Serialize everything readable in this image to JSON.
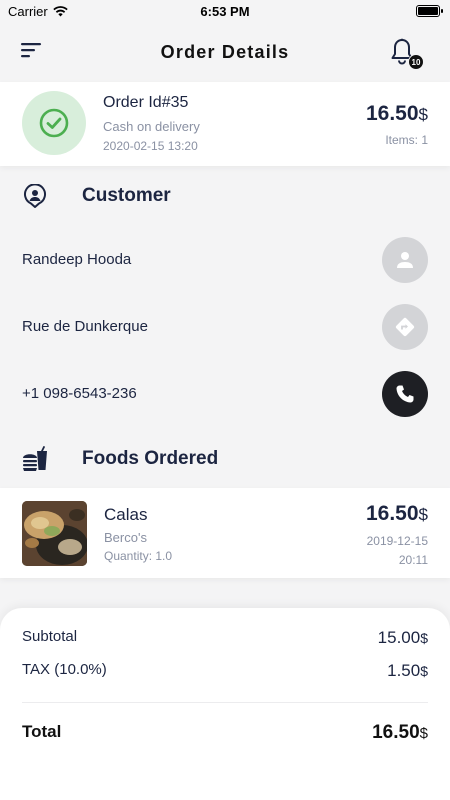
{
  "status_bar": {
    "carrier": "Carrier",
    "time": "6:53 PM"
  },
  "nav": {
    "title": "Order Details",
    "notification_count": "10"
  },
  "order": {
    "id_label": "Order Id#35",
    "payment_method": "Cash on delivery",
    "date": "2020-02-15 13:20",
    "price": "16.50",
    "currency": "$",
    "items": "Items: 1"
  },
  "customer": {
    "section_title": "Customer",
    "name": "Randeep Hooda",
    "address": "Rue de Dunkerque",
    "phone": "+1 098-6543-236"
  },
  "foods": {
    "section_title": "Foods Ordered",
    "items": [
      {
        "name": "Calas",
        "restaurant": "Berco's",
        "quantity": "Quantity: 1.0",
        "price": "16.50",
        "currency": "$",
        "date": "2019-12-15",
        "time": "20:11"
      }
    ]
  },
  "totals": {
    "subtotal_label": "Subtotal",
    "subtotal_value": "15.00",
    "tax_label": "TAX (10.0%)",
    "tax_value": "1.50",
    "total_label": "Total",
    "total_value": "16.50",
    "currency": "$"
  },
  "colors": {
    "primary": "#1c2541",
    "muted": "#8a91a3",
    "success": "#4caf50",
    "success_bg": "#d8eedb",
    "button_gray": "#d3d4d7",
    "button_dark": "#1e1f24"
  },
  "icons": {
    "menu": "menu-icon",
    "notification": "bell-icon",
    "check": "check-circle-icon",
    "customer": "user-pin-icon",
    "person": "person-icon",
    "directions": "directions-icon",
    "phone": "phone-icon",
    "food": "fast-food-icon"
  }
}
